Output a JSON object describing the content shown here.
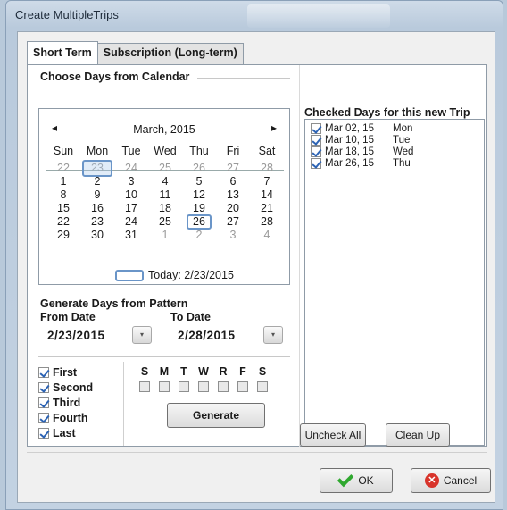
{
  "window": {
    "title": "Create MultipleTrips"
  },
  "tabs": [
    {
      "label": "Short Term",
      "active": true
    },
    {
      "label": "Subscription (Long-term)",
      "active": false
    }
  ],
  "calendar_group": {
    "title": "Choose Days from Calendar"
  },
  "calendar": {
    "month_label": "March, 2015",
    "prev_arrow": "◂",
    "next_arrow": "▸",
    "weekday_headers": [
      "Sun",
      "Mon",
      "Tue",
      "Wed",
      "Thu",
      "Fri",
      "Sat"
    ],
    "weeks": [
      [
        "22",
        "23",
        "24",
        "25",
        "26",
        "27",
        "28"
      ],
      [
        "1",
        "2",
        "3",
        "4",
        "5",
        "6",
        "7"
      ],
      [
        "8",
        "9",
        "10",
        "11",
        "12",
        "13",
        "14"
      ],
      [
        "15",
        "16",
        "17",
        "18",
        "19",
        "20",
        "21"
      ],
      [
        "22",
        "23",
        "24",
        "25",
        "26",
        "27",
        "28"
      ],
      [
        "29",
        "30",
        "31",
        "1",
        "2",
        "3",
        "4"
      ]
    ],
    "today_label": "Today: 2/23/2015"
  },
  "pattern_group": {
    "title": "Generate Days from Pattern"
  },
  "from_date": {
    "label": "From Date",
    "value": "2/23/2015",
    "dropdown_glyph": "▾"
  },
  "to_date": {
    "label": "To Date",
    "value": "2/28/2015",
    "dropdown_glyph": "▾"
  },
  "week_occurrences": [
    {
      "label": "First",
      "checked": true
    },
    {
      "label": "Second",
      "checked": true
    },
    {
      "label": "Third",
      "checked": true
    },
    {
      "label": "Fourth",
      "checked": true
    },
    {
      "label": "Last",
      "checked": true
    }
  ],
  "weekday_letters": [
    "S",
    "M",
    "T",
    "W",
    "R",
    "F",
    "S"
  ],
  "generate_button": {
    "label": "Generate"
  },
  "checked_days": {
    "title": "Checked Days for this new Trip",
    "items": [
      {
        "date": "Mar 02, 15",
        "day": "Mon",
        "checked": true
      },
      {
        "date": "Mar 10, 15",
        "day": "Tue",
        "checked": true
      },
      {
        "date": "Mar 18, 15",
        "day": "Wed",
        "checked": true
      },
      {
        "date": "Mar 26, 15",
        "day": "Thu",
        "checked": true
      }
    ]
  },
  "uncheck_all_button": {
    "label": "Uncheck All"
  },
  "clean_up_button": {
    "label": "Clean Up"
  },
  "ok_button": {
    "label": "OK"
  },
  "cancel_button": {
    "label": "Cancel",
    "icon_glyph": "✕"
  },
  "colors": {
    "selection_blue": "#6a95c8",
    "check_blue": "#2c63b4",
    "ok_green": "#2fa82f",
    "cancel_red": "#d8342b"
  }
}
